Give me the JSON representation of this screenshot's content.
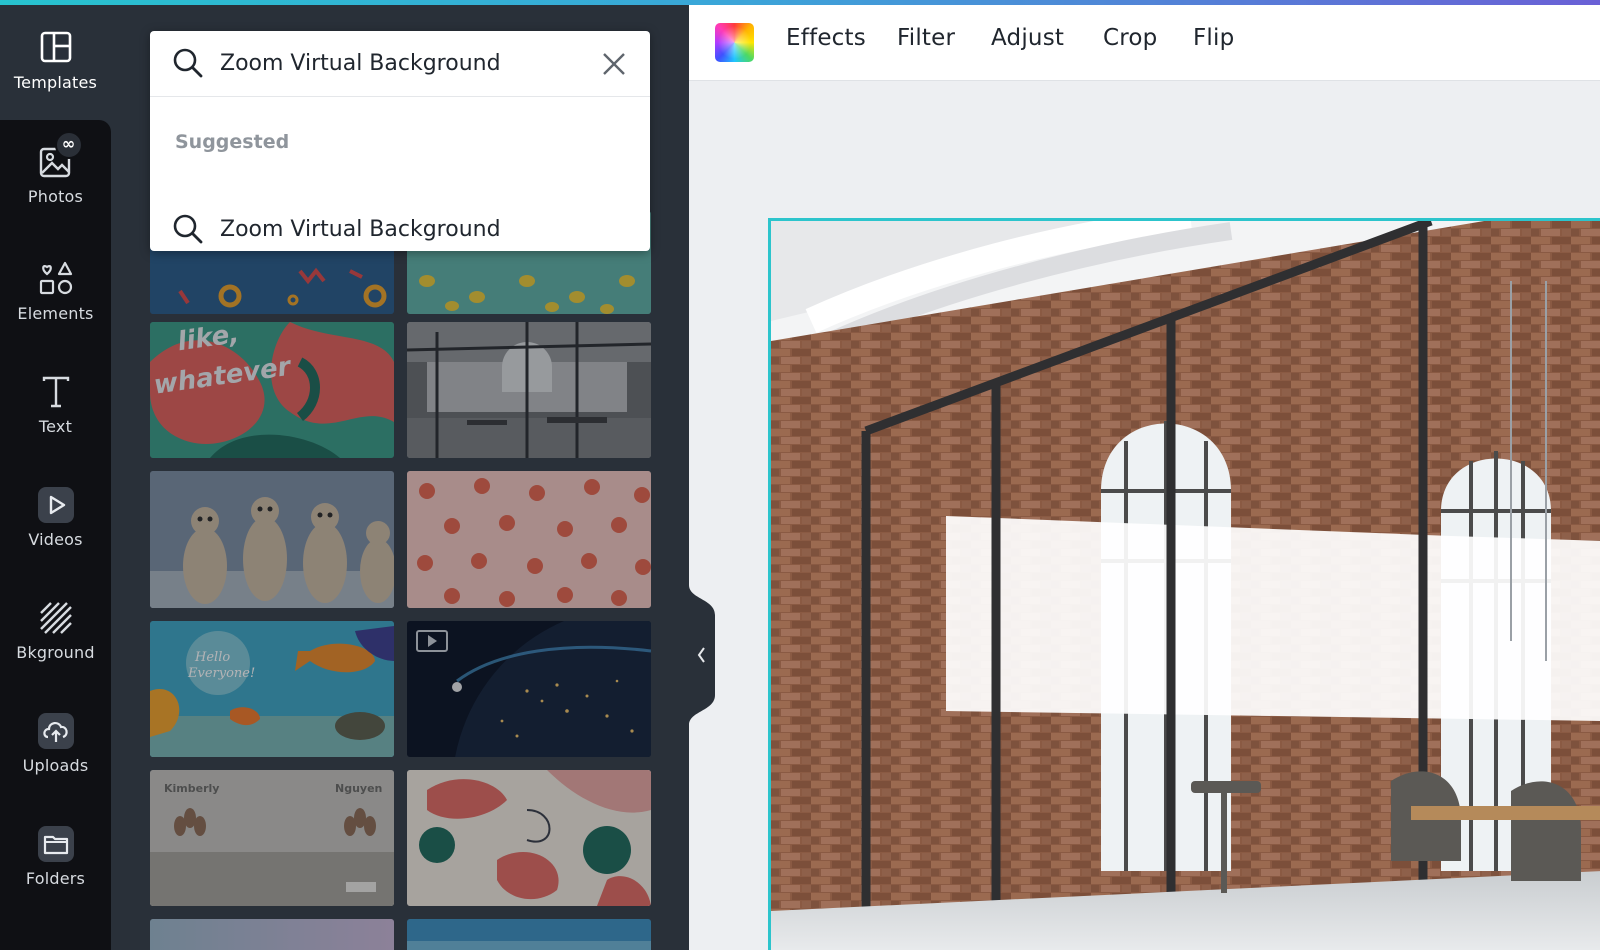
{
  "colors": {
    "accent": "#2cc4cc",
    "rail_bg": "#0f1014",
    "panel_bg": "#293039",
    "canvas_bg": "#edeff2"
  },
  "sidebar": {
    "items": [
      {
        "label": "Templates",
        "icon": "templates-icon",
        "active": true
      },
      {
        "label": "Photos",
        "icon": "photos-icon",
        "badge": "∞"
      },
      {
        "label": "Elements",
        "icon": "elements-icon"
      },
      {
        "label": "Text",
        "icon": "text-icon"
      },
      {
        "label": "Videos",
        "icon": "videos-icon"
      },
      {
        "label": "Bkground",
        "icon": "background-icon"
      },
      {
        "label": "Uploads",
        "icon": "uploads-icon"
      },
      {
        "label": "Folders",
        "icon": "folders-icon"
      }
    ]
  },
  "search": {
    "value": "Zoom Virtual Background",
    "suggested_heading": "Suggested",
    "suggestions": [
      "Zoom Virtual Background"
    ]
  },
  "results": {
    "tiles": [
      {
        "name": "memphis-pattern"
      },
      {
        "name": "lemon-pattern"
      },
      {
        "name": "like-whatever",
        "text_line1": "like,",
        "text_line2": "whatever"
      },
      {
        "name": "glass-office"
      },
      {
        "name": "meerkats"
      },
      {
        "name": "peach-pattern"
      },
      {
        "name": "hello-everyone-sea",
        "text_line1": "Hello",
        "text_line2": "Everyone!"
      },
      {
        "name": "earth-night",
        "is_video": true
      },
      {
        "name": "kimberly-nguyen",
        "text_left": "Kimberly",
        "text_right": "Nguyen"
      },
      {
        "name": "abstract-shapes"
      },
      {
        "name": "partial-1"
      },
      {
        "name": "partial-2"
      }
    ]
  },
  "toolbar": {
    "effects": "Effects",
    "filter": "Filter",
    "adjust": "Adjust",
    "crop": "Crop",
    "flip": "Flip"
  },
  "canvas": {
    "image": "office-interior-brick-glass"
  }
}
